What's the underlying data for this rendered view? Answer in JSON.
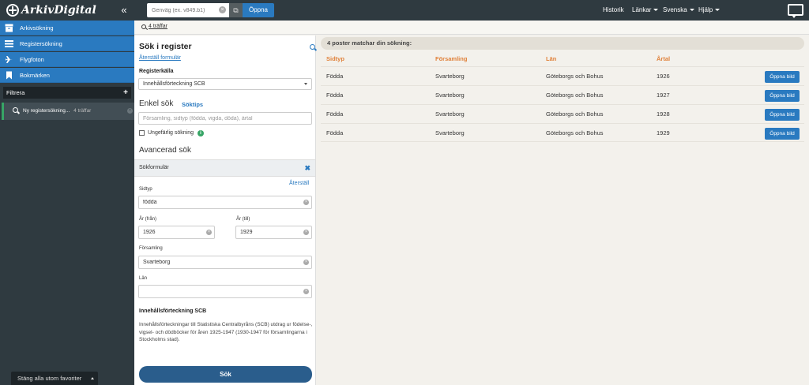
{
  "brand": {
    "name": "ArkivDigital"
  },
  "topbar": {
    "collapse_icon": "double-chevron-left-icon",
    "shortcut_placeholder": "Genväg (ex. v849.b1)",
    "open_label": "Öppna",
    "nav": {
      "history": "Historik",
      "links": "Länkar",
      "language": "Svenska",
      "help": "Hjälp"
    }
  },
  "sidebar": {
    "items": [
      {
        "label": "Arkivsökning",
        "icon": "archive-icon"
      },
      {
        "label": "Registersökning",
        "icon": "list-icon"
      },
      {
        "label": "Flygfoton",
        "icon": "plane-icon"
      },
      {
        "label": "Bokmärken",
        "icon": "bookmark-icon"
      }
    ],
    "filter_label": "Filtrera",
    "saved_search": {
      "label": "Ny registersökning...",
      "hits": "4 träffar"
    },
    "close_all_label": "Stäng alla utom favoriter"
  },
  "breadcrumb": {
    "label": "4 träffar"
  },
  "search_panel": {
    "title": "Sök i register",
    "reset_form": "Återställ formulär",
    "source_label": "Registerkälla",
    "source_value": "Innehållsförteckning SCB",
    "simple_title": "Enkel sök",
    "tips_label": "Söktips",
    "simple_placeholder": "Församling, sidtyp (födda, vigda, döda), årtal",
    "approx_label": "Ungefärlig sökning",
    "advanced_title": "Avancerad sök",
    "form_header": "Sökformulär",
    "reset_label": "Återställ",
    "fields": {
      "sidtyp": {
        "label": "Sidtyp",
        "value": "födda"
      },
      "year_from": {
        "label": "År (från)",
        "value": "1926"
      },
      "year_to": {
        "label": "År (till)",
        "value": "1929"
      },
      "parish": {
        "label": "Församling",
        "value": "Svarteborg"
      },
      "county": {
        "label": "Län",
        "value": ""
      }
    },
    "info_title": "Innehållsförteckning SCB",
    "info_text": "Innehållsförteckningar till Statistiska Centralbyråns (SCB) utdrag ur födelse-, vigsel- och dödböcker för åren 1925-1947 (1930-1947 för församlingarna i Stockholms stad).",
    "search_button": "Sök"
  },
  "results": {
    "summary": "4 poster matchar din sökning:",
    "columns": [
      "Sidtyp",
      "Församling",
      "Län",
      "Årtal"
    ],
    "open_image_label": "Öppna bild",
    "rows": [
      [
        "Födda",
        "Svarteborg",
        "Göteborgs och Bohus",
        "1926"
      ],
      [
        "Födda",
        "Svarteborg",
        "Göteborgs och Bohus",
        "1927"
      ],
      [
        "Födda",
        "Svarteborg",
        "Göteborgs och Bohus",
        "1928"
      ],
      [
        "Födda",
        "Svarteborg",
        "Göteborgs och Bohus",
        "1929"
      ]
    ]
  },
  "colors": {
    "topbar": "#2f3a40",
    "accent_blue": "#2a7ac0",
    "header_orange": "#e0813a",
    "search_button": "#2a5d8c",
    "active_green": "#37a566"
  }
}
